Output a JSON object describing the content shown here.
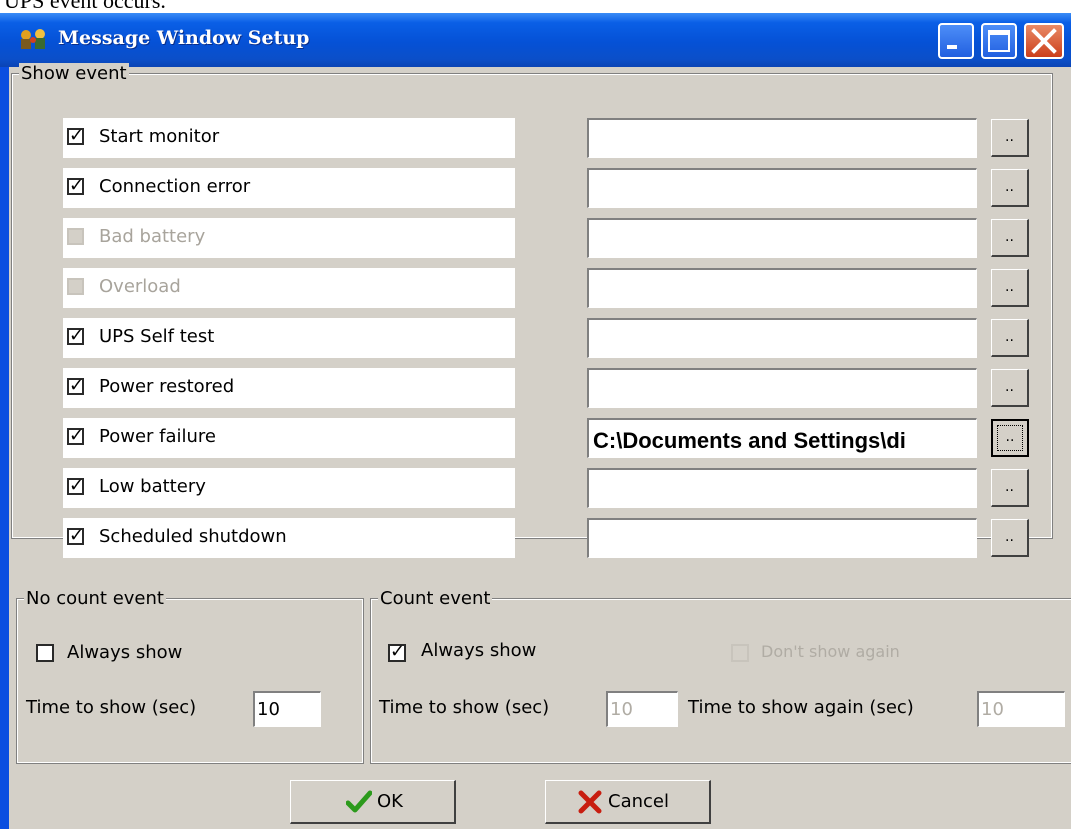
{
  "cutoff_text": "UPS event occurs.",
  "window": {
    "title": "Message Window Setup",
    "buttons": {
      "minimize_icon": "minimize-icon",
      "maximize_icon": "maximize-icon",
      "close_icon": "close-icon"
    }
  },
  "show_event": {
    "title": "Show event",
    "items": [
      {
        "label": "Start monitor",
        "checked": true,
        "enabled": true,
        "path": ""
      },
      {
        "label": "Connection error",
        "checked": true,
        "enabled": true,
        "path": ""
      },
      {
        "label": "Bad battery",
        "checked": false,
        "enabled": false,
        "path": ""
      },
      {
        "label": "Overload",
        "checked": false,
        "enabled": false,
        "path": ""
      },
      {
        "label": "UPS Self test",
        "checked": true,
        "enabled": true,
        "path": ""
      },
      {
        "label": "Power restored",
        "checked": true,
        "enabled": true,
        "path": ""
      },
      {
        "label": "Power failure",
        "checked": true,
        "enabled": true,
        "path": "C:\\Documents and Settings\\di"
      },
      {
        "label": "Low battery",
        "checked": true,
        "enabled": true,
        "path": ""
      },
      {
        "label": "Scheduled shutdown",
        "checked": true,
        "enabled": true,
        "path": ""
      }
    ],
    "browse_label": ".."
  },
  "no_count_event": {
    "title": "No count event",
    "always_show_label": "Always show",
    "always_show_checked": false,
    "time_label": "Time to show (sec)",
    "time_value": "10"
  },
  "count_event": {
    "title": "Count event",
    "always_show_label": "Always show",
    "always_show_checked": true,
    "dont_show_again_label": "Don't show again",
    "time_label": "Time to show (sec)",
    "time_value": "10",
    "again_label": "Time to show again (sec)",
    "again_value": "10"
  },
  "footer": {
    "ok_label": "OK",
    "cancel_label": "Cancel"
  },
  "colors": {
    "title_bar": "#0a5fe6",
    "dialog_bg": "#d4d0c8",
    "ok_check": "#2c9a1c",
    "cancel_x": "#c81e10"
  }
}
